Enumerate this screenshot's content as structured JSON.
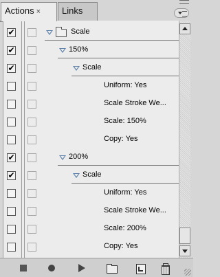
{
  "tabs": [
    {
      "label": "Actions",
      "close": "×",
      "active": true
    },
    {
      "label": "Links",
      "active": false
    }
  ],
  "rows": [
    {
      "label": "Scale",
      "checked": true,
      "indent": 0,
      "type": "set",
      "underline": true
    },
    {
      "label": "150%",
      "checked": true,
      "indent": 1,
      "type": "action",
      "underline": true
    },
    {
      "label": "Scale",
      "checked": true,
      "indent": 2,
      "type": "command",
      "underline": true
    },
    {
      "label": "Uniform: Yes",
      "checked": false,
      "indent": 3,
      "type": "param"
    },
    {
      "label": "Scale Stroke We...",
      "checked": false,
      "indent": 3,
      "type": "param"
    },
    {
      "label": "Scale: 150%",
      "checked": false,
      "indent": 3,
      "type": "param"
    },
    {
      "label": "Copy: Yes",
      "checked": false,
      "indent": 3,
      "type": "param"
    },
    {
      "label": "200%",
      "checked": true,
      "indent": 1,
      "type": "action",
      "underline": true
    },
    {
      "label": "Scale",
      "checked": true,
      "indent": 2,
      "type": "command",
      "underline": true
    },
    {
      "label": "Uniform: Yes",
      "checked": false,
      "indent": 3,
      "type": "param"
    },
    {
      "label": "Scale Stroke We...",
      "checked": false,
      "indent": 3,
      "type": "param"
    },
    {
      "label": "Scale: 200%",
      "checked": false,
      "indent": 3,
      "type": "param"
    },
    {
      "label": "Copy: Yes",
      "checked": false,
      "indent": 3,
      "type": "param"
    }
  ],
  "checkmark": "✔",
  "toolbar": [
    "stop-icon",
    "record-icon",
    "play-icon",
    "new-set-icon",
    "new-action-icon",
    "delete-icon"
  ],
  "colors": {
    "panel_bg": "#ececec",
    "triangle": "#5b7fa8"
  }
}
